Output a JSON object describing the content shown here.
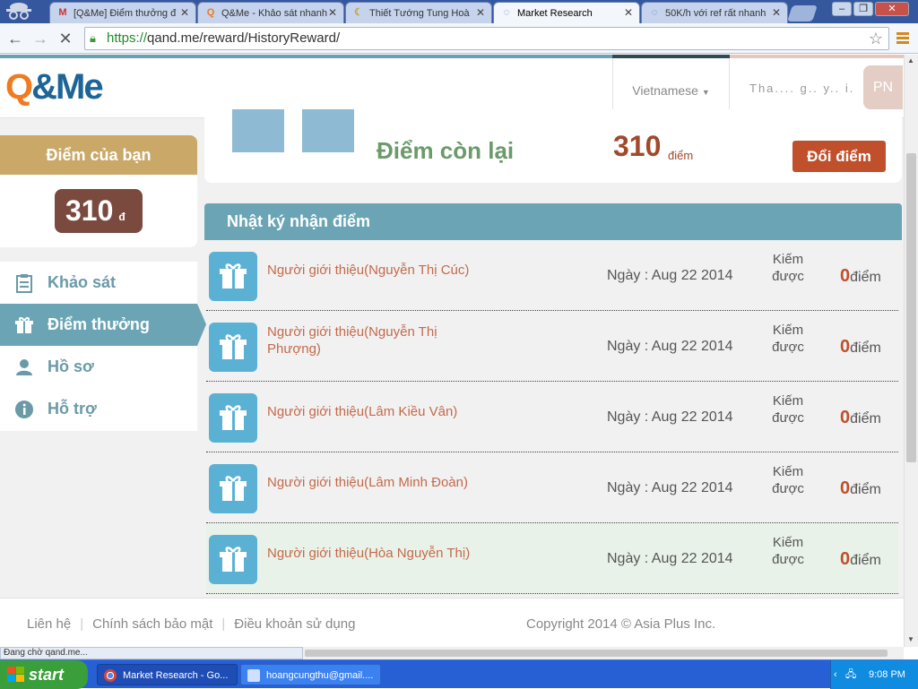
{
  "browser": {
    "tabs": [
      {
        "title": "[Q&Me] Điểm thưởng đ",
        "icon": "gmail-icon",
        "active": false
      },
      {
        "title": "Q&Me - Khảo sát nhanh",
        "icon": "qme-icon",
        "active": false
      },
      {
        "title": "Thiết Tướng Tung Hoà",
        "icon": "moon-icon",
        "active": false
      },
      {
        "title": "Market Research",
        "icon": "loading-icon",
        "active": true
      },
      {
        "title": "50K/h với ref rất nhanh",
        "icon": "loading-icon",
        "active": false
      }
    ],
    "url_scheme": "https://",
    "url_rest": "qand.me/reward/HistoryReward/",
    "status_text": "Đang chờ qand.me..."
  },
  "header": {
    "language": "Vietnamese",
    "user_name": "Tha.... g.. y.. i.",
    "avatar_initials": "PN"
  },
  "score_card": {
    "title": "Điểm của bạn",
    "value": "310",
    "unit": "đ"
  },
  "sidebar": {
    "items": [
      {
        "label": "Khảo sát",
        "icon": "clipboard-icon",
        "active": false
      },
      {
        "label": "Điểm thưởng",
        "icon": "gift-icon",
        "active": true
      },
      {
        "label": "Hồ sơ",
        "icon": "user-icon",
        "active": false
      },
      {
        "label": "Hỗ trợ",
        "icon": "info-icon",
        "active": false
      }
    ]
  },
  "balance": {
    "label": "Điểm còn lại",
    "value": "310",
    "unit": "điểm",
    "redeem_label": "Đổi điểm"
  },
  "log": {
    "title": "Nhật ký nhận điểm",
    "rows": [
      {
        "name": "Người giới thiệu(Nguyễn Thị Cúc)",
        "date": "Ngày : Aug 22 2014",
        "earn_label": "Kiếm được",
        "points": "0",
        "unit": "điểm"
      },
      {
        "name": "Người giới thiệu(Nguyễn Thị Phượng)",
        "date": "Ngày : Aug 22 2014",
        "earn_label": "Kiếm được",
        "points": "0",
        "unit": "điểm"
      },
      {
        "name": "Người giới thiệu(Lâm Kiều Vân)",
        "date": "Ngày : Aug 22 2014",
        "earn_label": "Kiếm được",
        "points": "0",
        "unit": "điểm"
      },
      {
        "name": "Người giới thiệu(Lâm Minh Đoàn)",
        "date": "Ngày : Aug 22 2014",
        "earn_label": "Kiếm được",
        "points": "0",
        "unit": "điểm"
      },
      {
        "name": "Người giới thiệu(Hòa Nguyễn Thị)",
        "date": "Ngày : Aug 22 2014",
        "earn_label": "Kiếm được",
        "points": "0",
        "unit": "điểm"
      }
    ]
  },
  "footer": {
    "links": [
      "Liên hệ",
      "Chính sách bảo mật",
      "Điều khoản sử dụng"
    ],
    "copyright": "Copyright 2014 © Asia Plus Inc."
  },
  "taskbar": {
    "start_label": "start",
    "items": [
      "Market Research - Go...",
      "hoangcungthu@gmail...."
    ],
    "clock": "9:08 PM"
  },
  "colors": {
    "accent_teal": "#6ba5b5",
    "score_gold": "#c9a868",
    "brown": "#7a4a3e",
    "redeem": "#c0502b",
    "link_orange": "#c46a4a"
  }
}
